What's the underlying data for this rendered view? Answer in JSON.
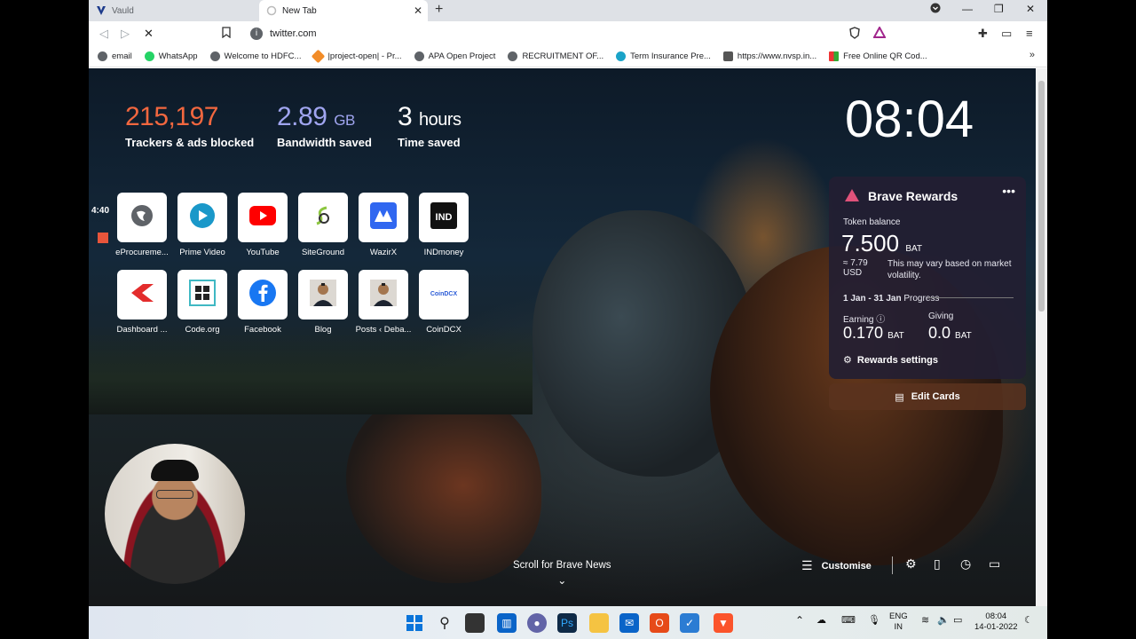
{
  "browser": {
    "tabs": [
      {
        "title": "Vauld",
        "active": false
      },
      {
        "title": "New Tab",
        "active": true
      }
    ],
    "url": "twitter.com",
    "bookmarks": [
      "email",
      "WhatsApp",
      "Welcome to HDFC...",
      "|project-open| - Pr...",
      "APA Open Project",
      "RECRUITMENT OF...",
      "Term Insurance Pre...",
      "https://www.nvsp.in...",
      "Free Online QR Cod..."
    ],
    "more_bookmarks": "»"
  },
  "stats": {
    "trackers_value": "215,197",
    "trackers_label": "Trackers & ads blocked",
    "bandwidth_value": "2.89",
    "bandwidth_unit": "GB",
    "bandwidth_label": "Bandwidth saved",
    "time_value": "3",
    "time_unit": "hours",
    "time_label": "Time saved"
  },
  "clock": "08:04",
  "top_sites": [
    {
      "name": "eProcureme...",
      "icon": "globe-icon"
    },
    {
      "name": "Prime Video",
      "icon": "play-icon"
    },
    {
      "name": "YouTube",
      "icon": "youtube-icon"
    },
    {
      "name": "SiteGround",
      "icon": "siteground-icon"
    },
    {
      "name": "WazirX",
      "icon": "wazirx-icon"
    },
    {
      "name": "INDmoney",
      "icon": "indmoney-icon"
    },
    {
      "name": "Dashboard ...",
      "icon": "dashboard-icon"
    },
    {
      "name": "Code.org",
      "icon": "codeorg-icon"
    },
    {
      "name": "Facebook",
      "icon": "facebook-icon"
    },
    {
      "name": "Blog",
      "icon": "portrait-icon"
    },
    {
      "name": "Posts ‹ Deba...",
      "icon": "portrait-icon"
    },
    {
      "name": "CoinDCX",
      "icon": "coindcx-icon"
    }
  ],
  "rewards": {
    "title": "Brave Rewards",
    "token_balance_label": "Token balance",
    "balance": "7.500",
    "balance_unit": "BAT",
    "usd": "≈ 7.79 USD",
    "volatility": "This may vary based on market volatility.",
    "period": "1 Jan - 31 Jan",
    "progress_label": "Progress",
    "earning_label": "Earning",
    "earning_value": "0.170",
    "giving_label": "Giving",
    "giving_value": "0.0",
    "unit": "BAT",
    "settings_label": "Rewards settings"
  },
  "edit_cards_label": "Edit Cards",
  "scroll_news_label": "Scroll for Brave News",
  "customise_label": "Customise",
  "recording": {
    "timer": "4:40"
  },
  "taskbar": {
    "lang_top": "ENG",
    "lang_bottom": "IN",
    "time": "08:04",
    "date": "14-01-2022"
  },
  "colors": {
    "trackers": "#f2673f",
    "bandwidth": "#a0a5f0",
    "rewards_bg": "#231e32"
  }
}
